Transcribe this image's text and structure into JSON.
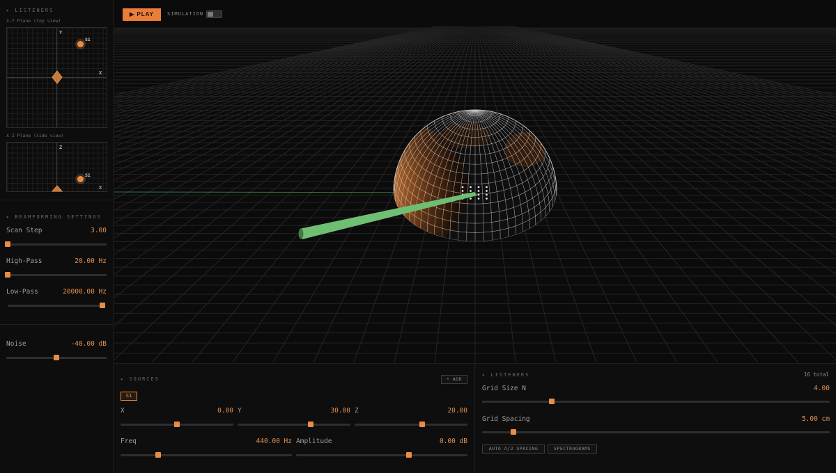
{
  "sidebar": {
    "listeners_title": "▸ LISTENERS",
    "xy_plane_label": "X-Y Plane (top view)",
    "xz_plane_label": "X-Z Plane (side view)",
    "xy_axes": {
      "vertical": "Y",
      "horizontal": "X"
    },
    "xz_axes": {
      "vertical": "Z",
      "horizontal": "X"
    },
    "source_label": "S1",
    "beamforming_title": "▸ BEAMFORMING SETTINGS",
    "scan_step": {
      "label": "Scan Step",
      "value": "3.00",
      "fraction": 0.0
    },
    "high_pass": {
      "label": "High-Pass",
      "value": "20.00 Hz",
      "fraction": 0.0
    },
    "low_pass": {
      "label": "Low-Pass",
      "value": "20000.00 Hz",
      "fraction": 1.0
    },
    "noise": {
      "label": "Noise",
      "value": "-40.00 dB",
      "fraction": 0.5
    }
  },
  "viewport": {
    "play_label": "▶ PLAY",
    "simulation_label": "SIMULATION",
    "simulation_on": false,
    "accent_color": "#e97d39",
    "beam_color": "#6fbf73"
  },
  "sources": {
    "title": "▸ SOURCES",
    "add_label": "+ ADD",
    "selected_chip": "S1",
    "x": {
      "label": "X",
      "value": "0.00",
      "fraction": 0.5
    },
    "y": {
      "label": "Y",
      "value": "30.00",
      "fraction": 0.65
    },
    "z": {
      "label": "Z",
      "value": "20.00",
      "fraction": 0.6
    },
    "freq": {
      "label": "Freq",
      "value": "440.00 Hz",
      "fraction": 0.22
    },
    "amplitude": {
      "label": "Amplitude",
      "value": "0.00 dB",
      "fraction": 0.66
    }
  },
  "listeners": {
    "title": "▸ LISTENERS",
    "total": "16 total",
    "grid_size": {
      "label": "Grid Size N",
      "value": "4.00",
      "fraction": 0.2
    },
    "grid_spacing": {
      "label": "Grid Spacing",
      "value": "5.00 cm",
      "fraction": 0.09
    },
    "auto_spacing_label": "AUTO λ/2 SPACING",
    "spectrograms_label": "SPECTROGRAMS"
  }
}
